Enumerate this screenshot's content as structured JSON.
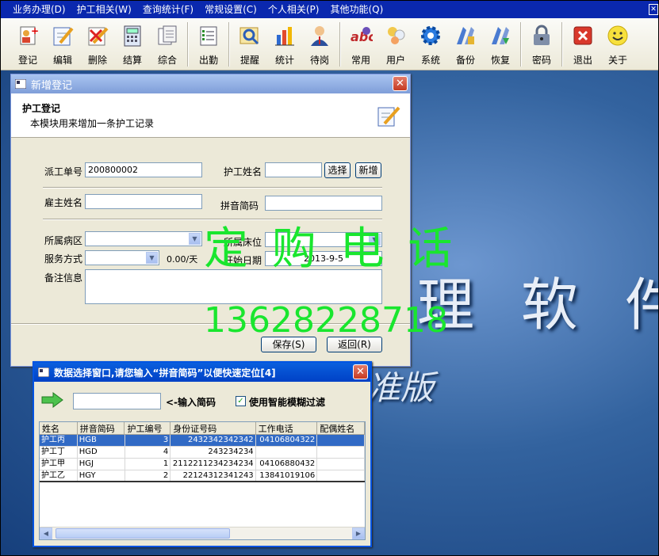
{
  "menubar": {
    "items": [
      "业务办理(D)",
      "护工相关(W)",
      "查询统计(F)",
      "常规设置(C)",
      "个人相关(P)",
      "其他功能(Q)"
    ]
  },
  "toolbar": {
    "buttons": [
      {
        "label": "登记",
        "icon": "register-icon"
      },
      {
        "label": "编辑",
        "icon": "edit-icon"
      },
      {
        "label": "删除",
        "icon": "delete-icon"
      },
      {
        "label": "结算",
        "icon": "settle-icon"
      },
      {
        "label": "综合",
        "icon": "summary-icon"
      },
      {
        "label": "出勤",
        "icon": "attendance-icon"
      },
      {
        "label": "提醒",
        "icon": "reminder-icon"
      },
      {
        "label": "统计",
        "icon": "statistics-icon"
      },
      {
        "label": "待岗",
        "icon": "standby-icon"
      },
      {
        "label": "常用",
        "icon": "common-icon"
      },
      {
        "label": "用户",
        "icon": "user-icon"
      },
      {
        "label": "系统",
        "icon": "system-icon"
      },
      {
        "label": "备份",
        "icon": "backup-icon"
      },
      {
        "label": "恢复",
        "icon": "restore-icon"
      },
      {
        "label": "密码",
        "icon": "password-icon"
      },
      {
        "label": "退出",
        "icon": "exit-icon"
      },
      {
        "label": "关于",
        "icon": "about-icon"
      }
    ]
  },
  "background": {
    "title": "理 软 件",
    "subtitle": "准版"
  },
  "register_window": {
    "title": "新增登记",
    "heading": "护工登记",
    "description": "本模块用来增加一条护工记录",
    "labels": {
      "dispatch_no": "派工单号",
      "nurse_name": "护工姓名",
      "employer_name": "雇主姓名",
      "pinyin_code": "拼音简码",
      "ward": "所属病区",
      "bed": "所属床位",
      "service_mode": "服务方式",
      "start_date": "开始日期",
      "remarks": "备注信息"
    },
    "values": {
      "dispatch_no": "200800002",
      "nurse_name": "",
      "employer_name": "",
      "pinyin_code": "",
      "ward": "",
      "bed": "",
      "service_mode": "",
      "price": "0.00/天",
      "start_date": "2013-9-5",
      "remarks": ""
    },
    "buttons": {
      "select": "选择",
      "new": "新增",
      "save": "保存(S)",
      "back": "返回(R)"
    }
  },
  "watermark": {
    "line1": "定 购 电 话",
    "line2": "13628228718"
  },
  "select_window": {
    "title": "数据选择窗口,请您输入“拼音简码”以便快速定位[4]",
    "input_hint": "<-输入简码",
    "input_value": "",
    "fuzzy_filter_label": "使用智能模糊过滤",
    "fuzzy_filter_checked": true,
    "columns": [
      "姓名",
      "拼音简码",
      "护工编号",
      "身份证号码",
      "工作电话",
      "配偶姓名"
    ],
    "rows": [
      [
        "护工丙",
        "HGB",
        "3",
        "2432342342342",
        "04106804322",
        ""
      ],
      [
        "护工丁",
        "HGD",
        "4",
        "243234234",
        "",
        ""
      ],
      [
        "护工甲",
        "HGJ",
        "1",
        "2112211234234234",
        "04106880432",
        ""
      ],
      [
        "护工乙",
        "HGY",
        "2",
        "22124312341243",
        "13841019106",
        ""
      ]
    ],
    "selected_row": 0
  },
  "colors": {
    "menubar": "#0a28ae",
    "selection": "#316ac5",
    "watermark": "#19e62e",
    "title_active": "#0054e3"
  }
}
